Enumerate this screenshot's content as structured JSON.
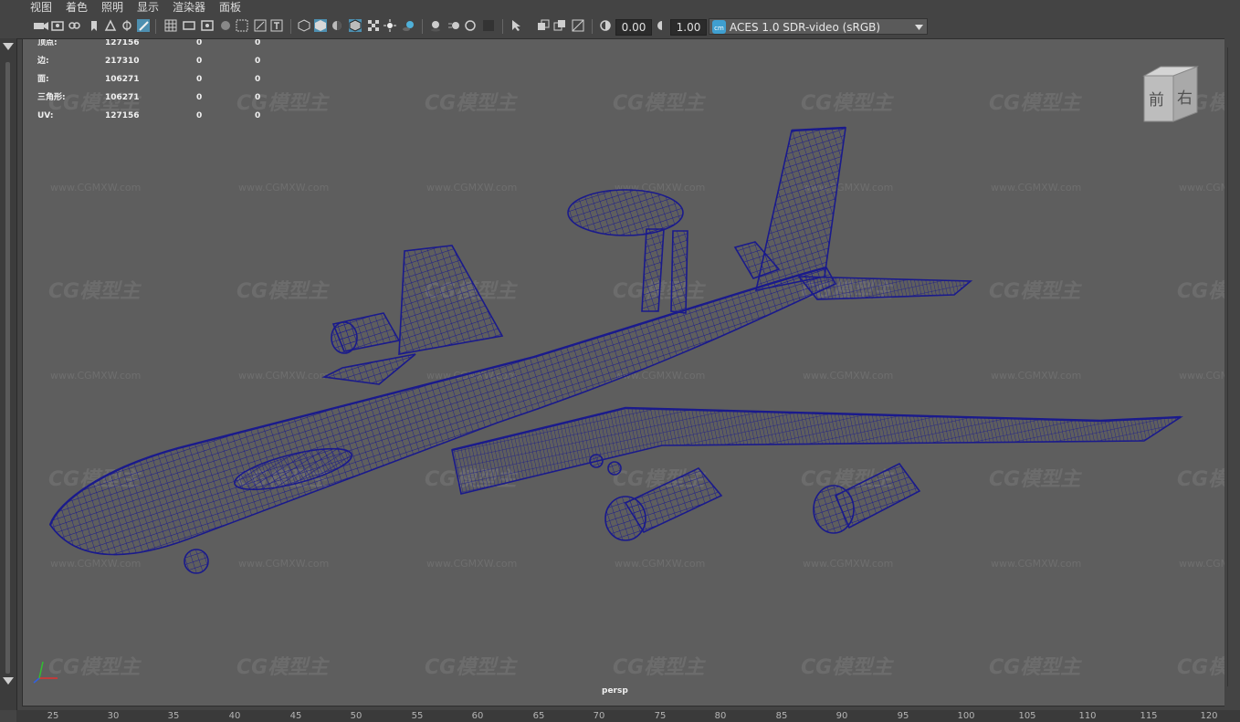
{
  "menubar": {
    "items": [
      "视图",
      "着色",
      "照明",
      "显示",
      "渲染器",
      "面板"
    ]
  },
  "toolbar": {
    "exposure_value": "0.00",
    "gamma_value": "1.00",
    "color_management": "ACES 1.0 SDR-video (sRGB)",
    "icons": [
      "camera-icon",
      "camera-attributes-icon",
      "bookmark-icon",
      "image-plane-icon",
      "grid-icon",
      "film-gate-icon",
      "resolution-gate-icon",
      "gate-mask-icon",
      "field-chart-icon",
      "safe-action-icon",
      "safe-title-icon",
      "wireframe-icon",
      "smooth-shade-icon",
      "default-material-icon",
      "wireframe-on-shaded-icon",
      "xray-icon",
      "use-all-lights-icon",
      "shadows-icon",
      "ambient-occlusion-icon",
      "motion-blur-icon",
      "anti-aliasing-icon",
      "isolate-select-icon",
      "xray-joints-icon",
      "texture-icon",
      "exposure-icon",
      "gamma-icon",
      "color-management-icon"
    ]
  },
  "hud": {
    "rows": [
      {
        "label": "顶点:",
        "v1": "127156",
        "v2": "0",
        "v3": "0"
      },
      {
        "label": "边:",
        "v1": "217310",
        "v2": "0",
        "v3": "0"
      },
      {
        "label": "面:",
        "v1": "106271",
        "v2": "0",
        "v3": "0"
      },
      {
        "label": "三角形:",
        "v1": "106271",
        "v2": "0",
        "v3": "0"
      },
      {
        "label": "UV:",
        "v1": "127156",
        "v2": "0",
        "v3": "0"
      }
    ]
  },
  "viewcube": {
    "front": "前",
    "right": "右"
  },
  "camera_name": "persp",
  "watermark": {
    "logo": "CG模型主",
    "url": "www.CGMXW.com"
  },
  "timeline": {
    "ticks": [
      "25",
      "30",
      "35",
      "40",
      "45",
      "50",
      "55",
      "60",
      "65",
      "70",
      "75",
      "80",
      "85",
      "90",
      "95",
      "100",
      "105",
      "110",
      "115",
      "120"
    ]
  },
  "colors": {
    "wireframe": "#1a1a8c",
    "viewport_bg": "#5e5e5e"
  }
}
